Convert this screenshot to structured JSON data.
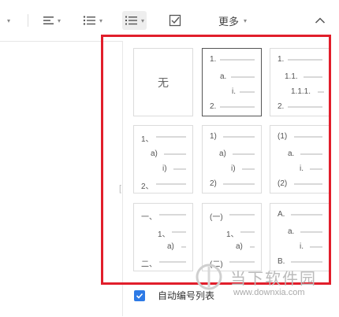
{
  "toolbar": {
    "more_label": "更多",
    "icons": [
      "align-left-icon",
      "bullet-list-icon",
      "numbered-list-icon",
      "checklist-icon",
      "chevron-up-icon"
    ]
  },
  "numbering_panel": {
    "none_label": "无",
    "styles": [
      {
        "lines": [
          "1.",
          "a.",
          "i.",
          "2."
        ]
      },
      {
        "lines": [
          "1.",
          "1.1.",
          "1.1.1.",
          "2."
        ]
      },
      {
        "lines": [
          "1、",
          "a)",
          "i)",
          "2、"
        ]
      },
      {
        "lines": [
          "1)",
          "a)",
          "i)",
          "2)"
        ]
      },
      {
        "lines": [
          "(1)",
          "a.",
          "i.",
          "(2)"
        ]
      },
      {
        "lines": [
          "一、",
          "1、",
          "a)",
          "二、"
        ]
      },
      {
        "lines": [
          "(一)",
          "1、",
          "a)",
          "(二)"
        ]
      },
      {
        "lines": [
          "A.",
          "a.",
          "i.",
          "B."
        ]
      }
    ],
    "auto_number_label": "自动编号列表",
    "auto_number_checked": true
  },
  "watermark": {
    "text": "当下软件园",
    "url": "www.downxia.com"
  },
  "colors": {
    "highlight_frame": "#e11e2b",
    "checkbox": "#2d7ae6"
  }
}
